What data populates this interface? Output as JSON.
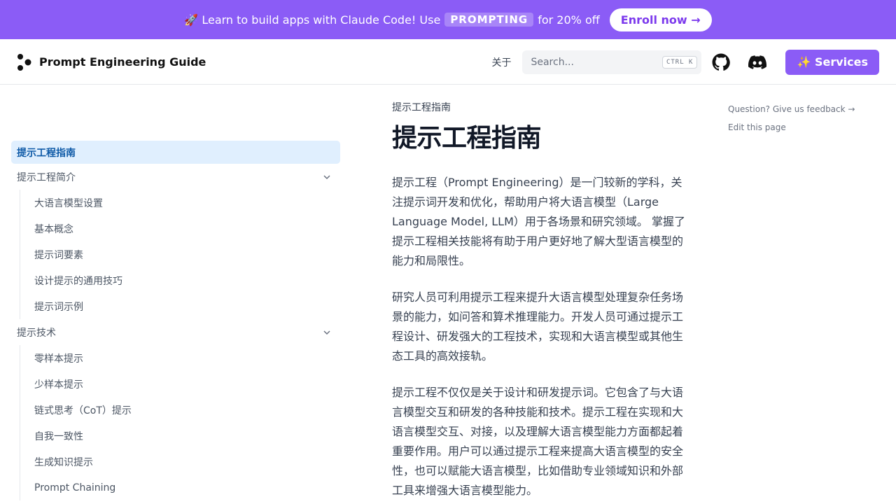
{
  "banner": {
    "prefix": "🚀 Learn to build apps with Claude Code! Use",
    "code": "PROMPTING",
    "suffix": "for 20% off",
    "cta": "Enroll now →"
  },
  "navbar": {
    "logo_text": "Prompt Engineering Guide",
    "about": "关于",
    "search_placeholder": "Search...",
    "search_kbd": "CTRL K",
    "services": "✨ Services"
  },
  "sidebar": {
    "active": "提示工程指南",
    "sections": [
      {
        "label": "提示工程简介",
        "items": [
          "大语言模型设置",
          "基本概念",
          "提示词要素",
          "设计提示的通用技巧",
          "提示词示例"
        ]
      },
      {
        "label": "提示技术",
        "items": [
          "零样本提示",
          "少样本提示",
          "链式思考（CoT）提示",
          "自我一致性",
          "生成知识提示",
          "Prompt Chaining"
        ]
      }
    ]
  },
  "main": {
    "breadcrumb": "提示工程指南",
    "title": "提示工程指南",
    "paragraphs": [
      "提示工程（Prompt Engineering）是一门较新的学科，关注提示词开发和优化，帮助用户将大语言模型（Large Language Model, LLM）用于各场景和研究领域。 掌握了提示工程相关技能将有助于用户更好地了解大型语言模型的能力和局限性。",
      "研究人员可利用提示工程来提升大语言模型处理复杂任务场景的能力，如问答和算术推理能力。开发人员可通过提示工程设计、研发强大的工程技术，实现和大语言模型或其他生态工具的高效接轨。",
      "提示工程不仅仅是关于设计和研发提示词。它包含了与大语言模型交互和研发的各种技能和技术。提示工程在实现和大语言模型交互、对接，以及理解大语言模型能力方面都起着重要作用。用户可以通过提示工程来提高大语言模型的安全性，也可以赋能大语言模型，比如借助专业领域知识和外部工具来增强大语言模型能力。"
    ]
  },
  "toc": {
    "feedback": "Question? Give us feedback →",
    "edit": "Edit this page"
  }
}
